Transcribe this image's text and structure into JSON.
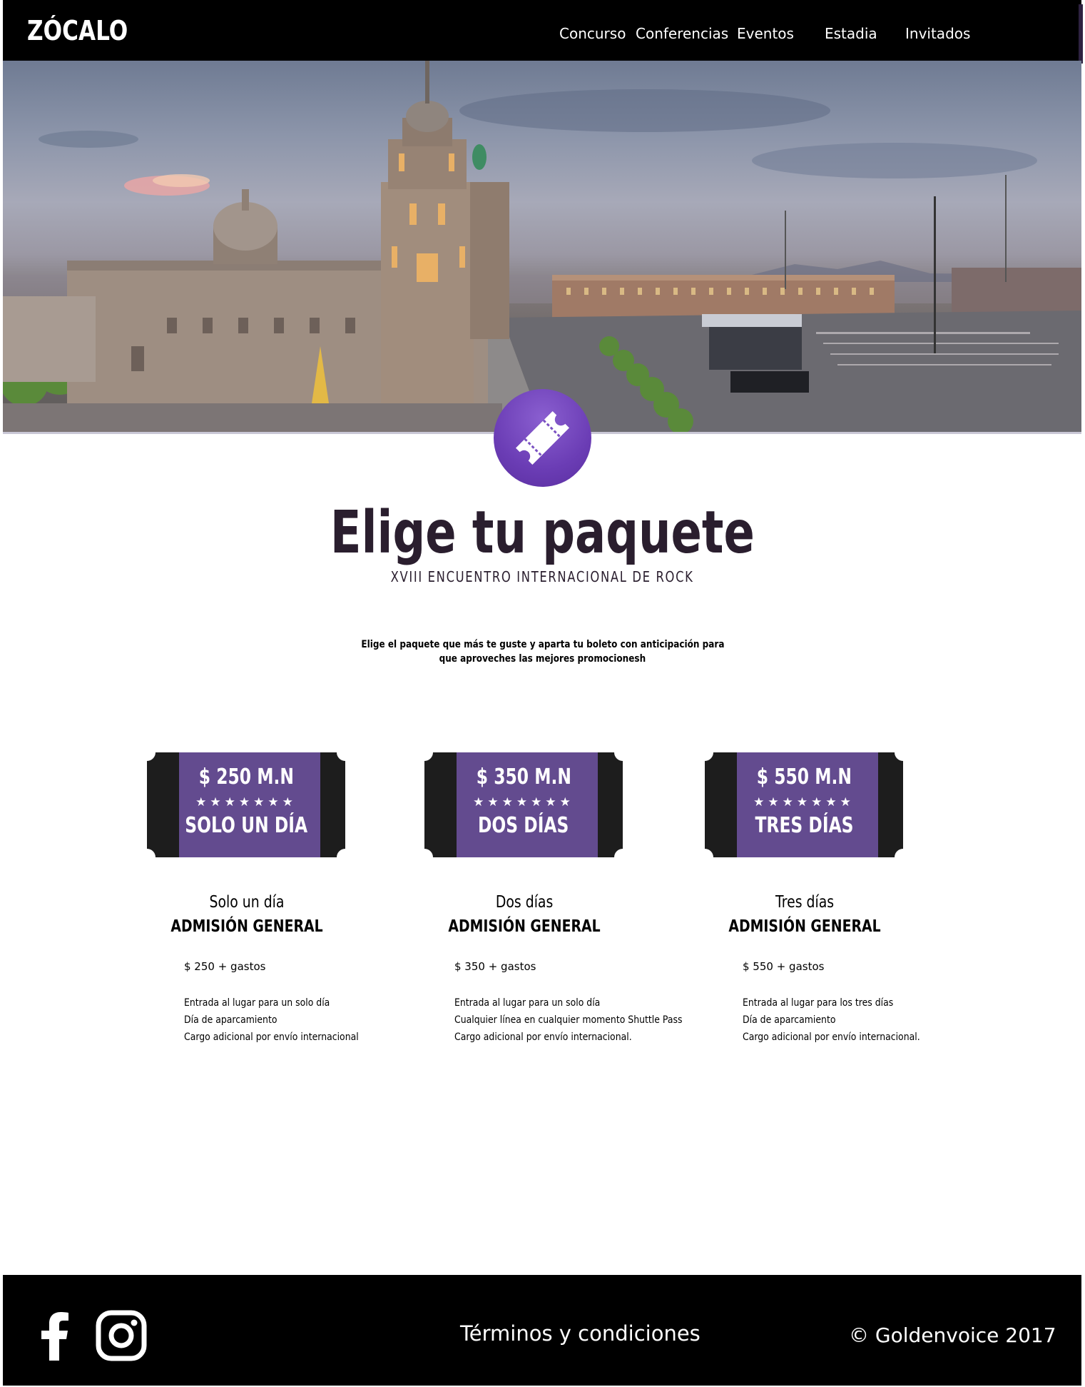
{
  "header": {
    "logo": "ZÓCALO",
    "nav": [
      "Concurso",
      "Conferencias",
      "Eventos",
      "Estadia",
      "Invitados"
    ]
  },
  "hero": {
    "icon": "ticket-icon"
  },
  "intro": {
    "title": "Elige tu paquete",
    "subtitle": "XVIII ENCUENTRO INTERNACIONAL DE ROCK",
    "description_line1": "Elige el paquete que más te guste y aparta tu boleto con anticipación para",
    "description_line2": "que aproveches las mejores promocionesh"
  },
  "packages": [
    {
      "badge_price": "$ 250 M.N",
      "badge_stars": "★★★★★★★",
      "badge_name": "SOLO UN DÍA",
      "heading": "Solo un día",
      "subheading": "ADMISIÓN GENERAL",
      "price": "$ 250 + gastos",
      "features": [
        "Entrada al lugar para un solo día",
        "Día de aparcamiento",
        "Cargo adicional por envío internacional"
      ]
    },
    {
      "badge_price": "$ 350 M.N",
      "badge_stars": "★★★★★★★",
      "badge_name": "DOS DÍAS",
      "heading": "Dos días",
      "subheading": "ADMISIÓN GENERAL",
      "price": "$ 350 + gastos",
      "features": [
        "Entrada al lugar para un solo día",
        "Cualquier línea en cualquier momento Shuttle Pass",
        "Cargo adicional por envío internacional."
      ]
    },
    {
      "badge_price": "$ 550 M.N",
      "badge_stars": "★★★★★★★",
      "badge_name": "TRES DÍAS",
      "heading": "Tres días",
      "subheading": "ADMISIÓN GENERAL",
      "price": "$ 550 + gastos",
      "features": [
        "Entrada al lugar para los tres días",
        "Día de aparcamiento",
        "Cargo adicional por envío internacional."
      ]
    }
  ],
  "footer": {
    "social": [
      "facebook-icon",
      "instagram-icon"
    ],
    "terms": "Términos y condiciones",
    "copyright": "© Goldenvoice 2017"
  },
  "colors": {
    "header_bg": "#000000",
    "accent_purple": "#634b8f",
    "ticket_dark": "#1d1d1d",
    "title_color": "#2a1e2e"
  }
}
